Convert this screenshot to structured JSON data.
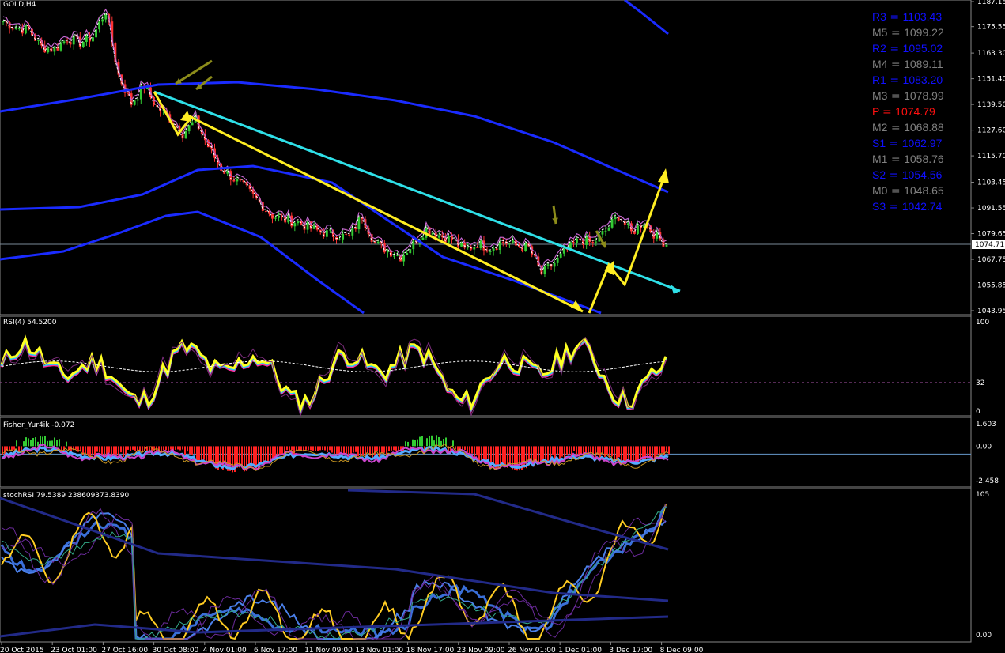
{
  "window": {
    "symbol_title": "GOLD,H4"
  },
  "pivots": [
    {
      "label": "R3",
      "value": "1103.43",
      "color": "#1010ff"
    },
    {
      "label": "M5",
      "value": "1099.22",
      "color": "#808080"
    },
    {
      "label": "R2",
      "value": "1095.02",
      "color": "#1010ff"
    },
    {
      "label": "M4",
      "value": "1089.11",
      "color": "#808080"
    },
    {
      "label": "R1",
      "value": "1083.20",
      "color": "#1010ff"
    },
    {
      "label": "M3",
      "value": "1078.99",
      "color": "#808080"
    },
    {
      "label": "P ",
      "value": "1074.79",
      "color": "#ff1010"
    },
    {
      "label": "M2",
      "value": "1068.88",
      "color": "#808080"
    },
    {
      "label": "S1",
      "value": "1062.97",
      "color": "#1010ff"
    },
    {
      "label": "M1",
      "value": "1058.76",
      "color": "#808080"
    },
    {
      "label": "S2",
      "value": "1054.56",
      "color": "#1010ff"
    },
    {
      "label": "M0",
      "value": "1048.65",
      "color": "#808080"
    },
    {
      "label": "S3",
      "value": "1042.74",
      "color": "#1010ff"
    }
  ],
  "chart_data": [
    {
      "type": "candlestick",
      "title": "GOLD,H4",
      "price_axis_ticks": [
        "1187.15",
        "1175.55",
        "1163.30",
        "1151.40",
        "1139.50",
        "1127.60",
        "1115.70",
        "1103.45",
        "1091.55",
        "1079.65",
        "1067.75",
        "1055.85",
        "1043.95"
      ],
      "current_price": "1074.71",
      "time_axis_ticks": [
        "20 Oct 2015",
        "23 Oct 01:00",
        "27 Oct 16:00",
        "30 Oct 08:00",
        "4 Nov 01:00",
        "6 Nov 17:00",
        "11 Nov 09:00",
        "13 Nov 01:00",
        "18 Nov 17:00",
        "23 Nov 09:00",
        "26 Nov 01:00",
        "1 Dec 01:00",
        "3 Dec 17:00",
        "8 Dec 09:00"
      ],
      "close_path": [
        1178,
        1175,
        1174,
        1166,
        1165,
        1170,
        1168,
        1171,
        1183,
        1153,
        1140,
        1148,
        1138,
        1133,
        1126,
        1132,
        1120,
        1110,
        1105,
        1100,
        1094,
        1088,
        1086,
        1085,
        1082,
        1080,
        1079,
        1078,
        1088,
        1075,
        1072,
        1069,
        1075,
        1082,
        1079,
        1077,
        1072,
        1075,
        1073,
        1076,
        1074,
        1073,
        1061,
        1066,
        1072,
        1077,
        1075,
        1081,
        1088,
        1080,
        1085,
        1078,
        1074
      ]
    },
    {
      "type": "line",
      "title": "RSI(4) 54.5200",
      "y_ticks": [
        "100",
        "32",
        "0"
      ]
    },
    {
      "type": "bar",
      "title": "Fisher_Yur4ik -0.072",
      "y_ticks": [
        "1.603",
        "0.00",
        "-2.458"
      ]
    },
    {
      "type": "line",
      "title": "stochRSI 79.5389 238609373.8390",
      "y_ticks": [
        "105",
        "0.00"
      ]
    }
  ]
}
